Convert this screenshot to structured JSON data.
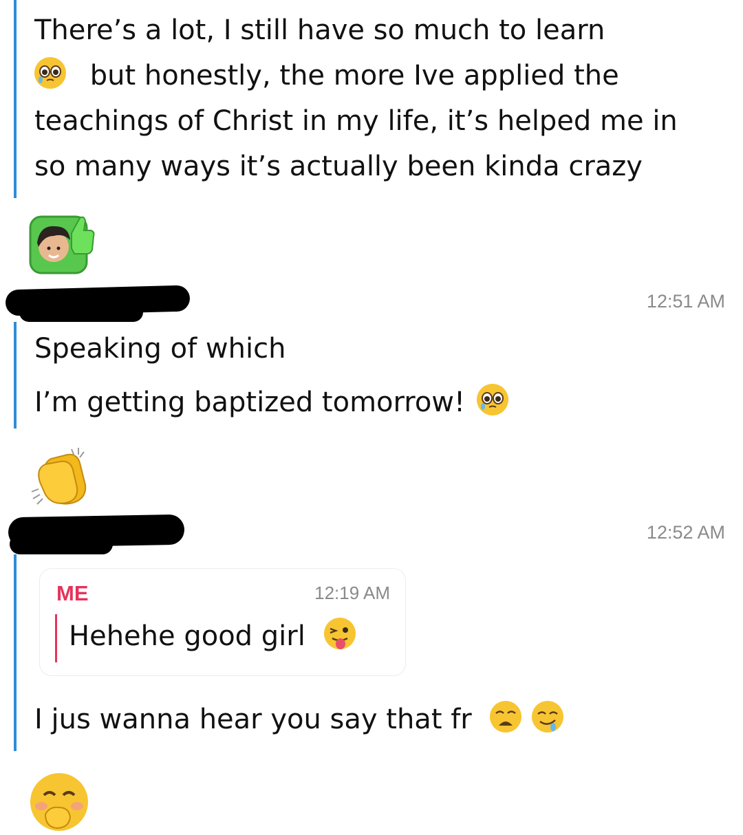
{
  "messages": {
    "first": {
      "lines": [
        "There’s a lot, I still have so much to learn",
        "but honestly, the more Ive applied the",
        "teachings of Christ in my life, it’s helped me in",
        "so many ways it’s actually been kinda crazy"
      ]
    },
    "second": {
      "timestamp": "12:51 AM",
      "line1": "Speaking of which",
      "line2": "I’m getting baptized tomorrow!"
    },
    "third": {
      "timestamp": "12:52 AM",
      "quote": {
        "sender": "ME",
        "time": "12:19 AM",
        "text": "Hehehe good girl"
      },
      "line": "I jus wanna hear you say that fr"
    }
  },
  "icons": {
    "pleading": "pleading-face-icon",
    "thumbs": "bitmoji-thumbs-up-icon",
    "clap": "clapping-hands-icon",
    "tongue": "winking-tongue-face-icon",
    "weary": "weary-face-icon",
    "drool": "drooling-face-icon",
    "hand_over_mouth": "face-with-hand-over-mouth-icon"
  },
  "colors": {
    "accent_blue": "#2f8cd6",
    "me_red": "#e5335a",
    "timestamp_gray": "#8a8a8a"
  }
}
